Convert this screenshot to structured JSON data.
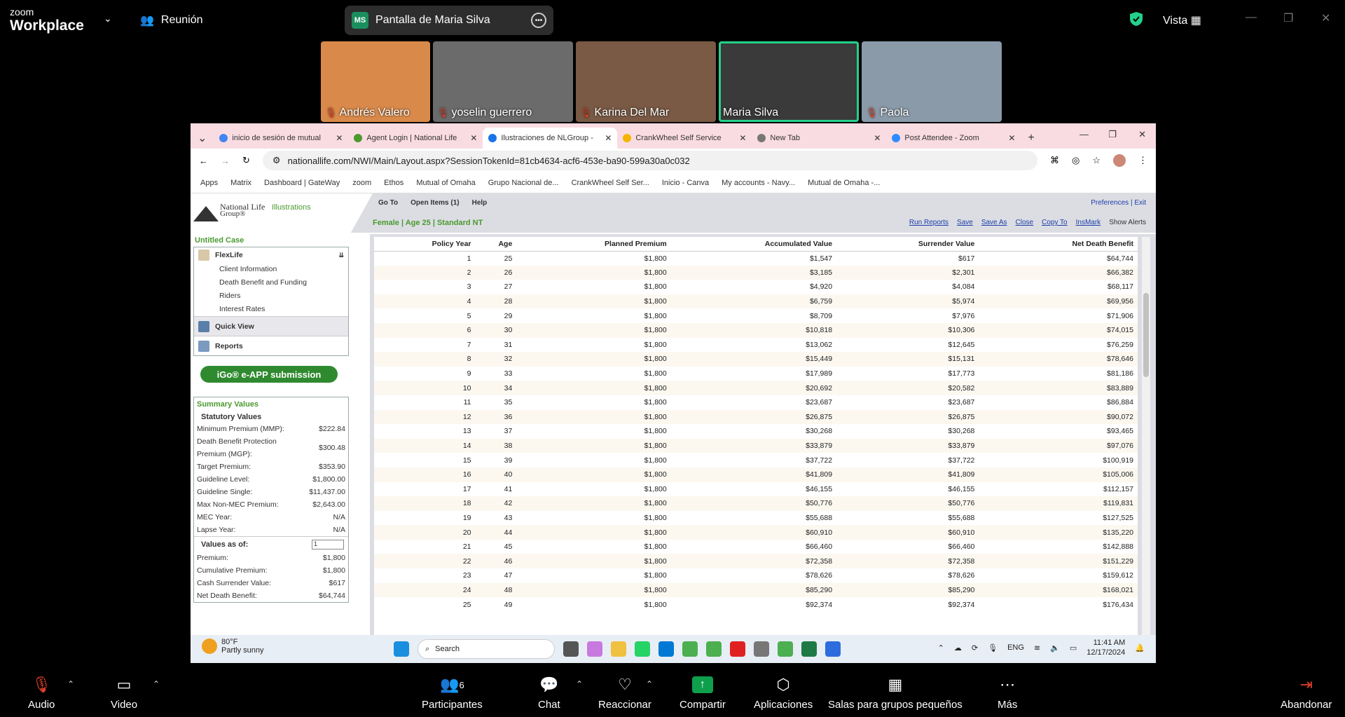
{
  "zoom": {
    "brand_small": "zoom",
    "brand_big": "Workplace",
    "meeting_label": "Reunión",
    "share_initials": "MS",
    "share_title": "Pantalla de Maria Silva",
    "view_label": "Vista",
    "participants": [
      {
        "name": "Andrés Valero",
        "muted": true,
        "bg": "#d98a4a"
      },
      {
        "name": "yoselin guerrero",
        "muted": true,
        "bg": "#6b6b6b"
      },
      {
        "name": "Karina Del Mar",
        "muted": true,
        "bg": "#7a5a45"
      },
      {
        "name": "Maria Silva",
        "muted": false,
        "bg": "#3a3a3a",
        "active": true
      },
      {
        "name": "Paola",
        "muted": true,
        "bg": "#8a9aa8"
      }
    ],
    "bottom": {
      "audio": "Audio",
      "video": "Video",
      "participants": "Participantes",
      "participants_count": "6",
      "chat": "Chat",
      "react": "Reaccionar",
      "share": "Compartir",
      "apps": "Aplicaciones",
      "breakout": "Salas para grupos pequeños",
      "more": "Más",
      "leave": "Abandonar"
    }
  },
  "browser": {
    "tabs": [
      {
        "title": "inicio de sesión de mutual",
        "color": "#4285f4",
        "active": false
      },
      {
        "title": "Agent Login | National Life",
        "color": "#4a9a2e",
        "active": false
      },
      {
        "title": "Ilustraciones de NLGroup -",
        "color": "#1a73e8",
        "active": true
      },
      {
        "title": "CrankWheel Self Service",
        "color": "#f4b400",
        "active": false
      },
      {
        "title": "New Tab",
        "color": "#777777",
        "active": false
      },
      {
        "title": "Post Attendee - Zoom",
        "color": "#2d8cff",
        "active": false
      }
    ],
    "url": "nationallife.com/NWI/Main/Layout.aspx?SessionTokenId=81cb4634-acf6-453e-ba90-599a30a0c032",
    "bookmarks": [
      "Apps",
      "Matrix",
      "Dashboard | GateWay",
      "zoom",
      "Ethos",
      "Mutual of Omaha",
      "Grupo Nacional de...",
      "CrankWheel Self Ser...",
      "Inicio - Canva",
      "My accounts - Navy...",
      "Mutual de Omaha -..."
    ]
  },
  "nl": {
    "logo_line1": "National Life",
    "logo_line2": "Group®",
    "logo_product": "Illustrations",
    "menu": [
      "Go To",
      "Open Items (1)",
      "Help"
    ],
    "preferences": "Preferences",
    "exit": "Exit",
    "case_label": "Female | Age 25 | Standard NT",
    "actions": [
      "Run Reports",
      "Save",
      "Save As",
      "Close",
      "Copy To",
      "InsMark"
    ],
    "show_alerts": "Show Alerts",
    "untitled_case": "Untitled Case",
    "product": "FlexLife",
    "nav_items": [
      "Client Information",
      "Death Benefit and Funding",
      "Riders",
      "Interest Rates"
    ],
    "quick_view": "Quick View",
    "reports": "Reports",
    "igo_button": "iGo® e-APP submission",
    "summary_title": "Summary Values",
    "statutory_title": "Statutory Values",
    "statutory": [
      {
        "label": "Minimum Premium (MMP):",
        "value": "$222.84"
      },
      {
        "label": "Death Benefit Protection Premium (MGP):",
        "value": "$300.48"
      },
      {
        "label": "Target Premium:",
        "value": "$353.90"
      },
      {
        "label": "Guideline Level:",
        "value": "$1,800.00"
      },
      {
        "label": "Guideline Single:",
        "value": "$11,437.00"
      },
      {
        "label": "Max Non-MEC Premium:",
        "value": "$2,643.00"
      },
      {
        "label": "MEC Year:",
        "value": "N/A"
      },
      {
        "label": "Lapse Year:",
        "value": "N/A"
      }
    ],
    "values_as_of_label": "Values as of:",
    "values_as_of_input": "1",
    "values": [
      {
        "label": "Premium:",
        "value": "$1,800"
      },
      {
        "label": "Cumulative Premium:",
        "value": "$1,800"
      },
      {
        "label": "Cash Surrender Value:",
        "value": "$617"
      },
      {
        "label": "Net Death Benefit:",
        "value": "$64,744"
      }
    ],
    "table_headers": [
      "Policy Year",
      "Age",
      "Planned Premium",
      "Accumulated Value",
      "Surrender Value",
      "Net Death Benefit"
    ],
    "rows": [
      [
        "1",
        "25",
        "$1,800",
        "$1,547",
        "$617",
        "$64,744"
      ],
      [
        "2",
        "26",
        "$1,800",
        "$3,185",
        "$2,301",
        "$66,382"
      ],
      [
        "3",
        "27",
        "$1,800",
        "$4,920",
        "$4,084",
        "$68,117"
      ],
      [
        "4",
        "28",
        "$1,800",
        "$6,759",
        "$5,974",
        "$69,956"
      ],
      [
        "5",
        "29",
        "$1,800",
        "$8,709",
        "$7,976",
        "$71,906"
      ],
      [
        "6",
        "30",
        "$1,800",
        "$10,818",
        "$10,306",
        "$74,015"
      ],
      [
        "7",
        "31",
        "$1,800",
        "$13,062",
        "$12,645",
        "$76,259"
      ],
      [
        "8",
        "32",
        "$1,800",
        "$15,449",
        "$15,131",
        "$78,646"
      ],
      [
        "9",
        "33",
        "$1,800",
        "$17,989",
        "$17,773",
        "$81,186"
      ],
      [
        "10",
        "34",
        "$1,800",
        "$20,692",
        "$20,582",
        "$83,889"
      ],
      [
        "11",
        "35",
        "$1,800",
        "$23,687",
        "$23,687",
        "$86,884"
      ],
      [
        "12",
        "36",
        "$1,800",
        "$26,875",
        "$26,875",
        "$90,072"
      ],
      [
        "13",
        "37",
        "$1,800",
        "$30,268",
        "$30,268",
        "$93,465"
      ],
      [
        "14",
        "38",
        "$1,800",
        "$33,879",
        "$33,879",
        "$97,076"
      ],
      [
        "15",
        "39",
        "$1,800",
        "$37,722",
        "$37,722",
        "$100,919"
      ],
      [
        "16",
        "40",
        "$1,800",
        "$41,809",
        "$41,809",
        "$105,006"
      ],
      [
        "17",
        "41",
        "$1,800",
        "$46,155",
        "$46,155",
        "$112,157"
      ],
      [
        "18",
        "42",
        "$1,800",
        "$50,776",
        "$50,776",
        "$119,831"
      ],
      [
        "19",
        "43",
        "$1,800",
        "$55,688",
        "$55,688",
        "$127,525"
      ],
      [
        "20",
        "44",
        "$1,800",
        "$60,910",
        "$60,910",
        "$135,220"
      ],
      [
        "21",
        "45",
        "$1,800",
        "$66,460",
        "$66,460",
        "$142,888"
      ],
      [
        "22",
        "46",
        "$1,800",
        "$72,358",
        "$72,358",
        "$151,229"
      ],
      [
        "23",
        "47",
        "$1,800",
        "$78,626",
        "$78,626",
        "$159,612"
      ],
      [
        "24",
        "48",
        "$1,800",
        "$85,290",
        "$85,290",
        "$168,021"
      ],
      [
        "25",
        "49",
        "$1,800",
        "$92,374",
        "$92,374",
        "$176,434"
      ]
    ]
  },
  "taskbar": {
    "temp": "80°F",
    "weather": "Partly sunny",
    "search_placeholder": "Search",
    "lang": "ENG",
    "time": "11:41 AM",
    "date": "12/17/2024"
  }
}
